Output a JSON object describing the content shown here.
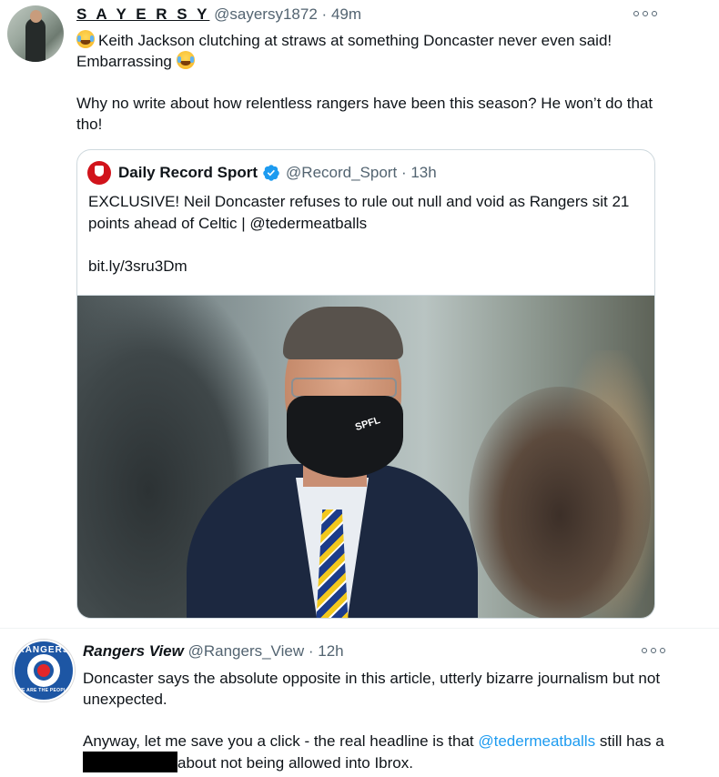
{
  "tweets": [
    {
      "display_name": "S A Y E R S Y",
      "handle": "@sayersy1872",
      "separator": "·",
      "time": "49m",
      "body_lines": [
        "Keith Jackson clutching at straws at something Doncaster never even said! Embarrassing",
        "Why no write about how relentless rangers have been this season? He won’t do that tho!"
      ],
      "quote": {
        "display_name": "Daily Record Sport",
        "handle": "@Record_Sport",
        "separator": "·",
        "time": "13h",
        "text_part1": "EXCLUSIVE! Neil Doncaster refuses to rule out null and void as Rangers sit 21 points ahead of Celtic | ",
        "mention": "@tedermeatballs",
        "link": "bit.ly/3sru3Dm",
        "image_mask_text": "SPFL"
      }
    },
    {
      "display_name": "Rangers View",
      "handle": "@Rangers_View",
      "separator": "·",
      "time": "12h",
      "avatar_text_top": "RANGERS",
      "avatar_text_bottom": "WE ARE THE PEOPLE",
      "line1": "Doncaster says the absolute opposite in this article, utterly bizarre journalism but not unexpected.",
      "line2_part1": "Anyway, let me save you a click - the real headline is that ",
      "line2_mention": "@tedermeatballs",
      "line2_part2": " still has a",
      "line2_part3": "about not being allowed into Ibrox."
    }
  ],
  "colors": {
    "text_primary": "#0f1419",
    "text_secondary": "#536471",
    "link": "#1d9bf0",
    "verified": "#1d9bf0"
  },
  "icons": {
    "more": "more-options-icon",
    "verified": "verified-badge-icon",
    "emoji": "face-with-tears-of-joy-emoji"
  }
}
